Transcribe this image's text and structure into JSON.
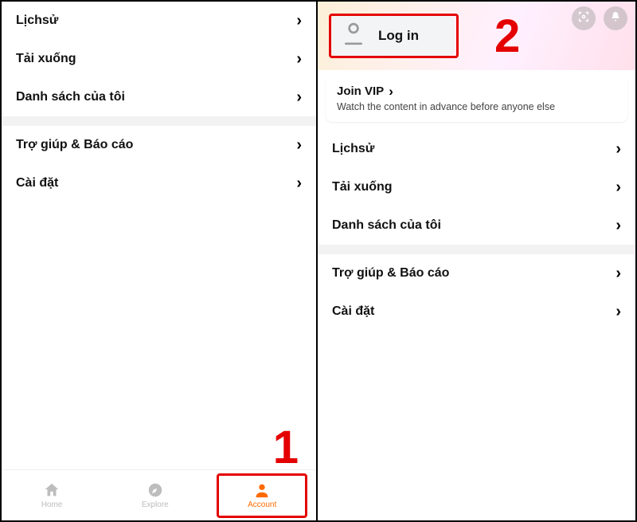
{
  "left": {
    "group1": [
      {
        "label": "Lịchsử"
      },
      {
        "label": "Tải xuống"
      },
      {
        "label": "Danh sách của tôi"
      }
    ],
    "group2": [
      {
        "label": "Trợ giúp & Báo cáo"
      },
      {
        "label": "Cài đặt"
      }
    ],
    "nav": {
      "home": "Home",
      "explore": "Explore",
      "account": "Account"
    }
  },
  "right": {
    "login_label": "Log in",
    "vip": {
      "title": "Join VIP",
      "subtitle": "Watch the content in advance before anyone else"
    },
    "group1": [
      {
        "label": "Lịchsử"
      },
      {
        "label": "Tải xuống"
      },
      {
        "label": "Danh sách của tôi"
      }
    ],
    "group2": [
      {
        "label": "Trợ giúp & Báo cáo"
      },
      {
        "label": "Cài đặt"
      }
    ]
  },
  "annotations": {
    "step1": "1",
    "step2": "2"
  }
}
